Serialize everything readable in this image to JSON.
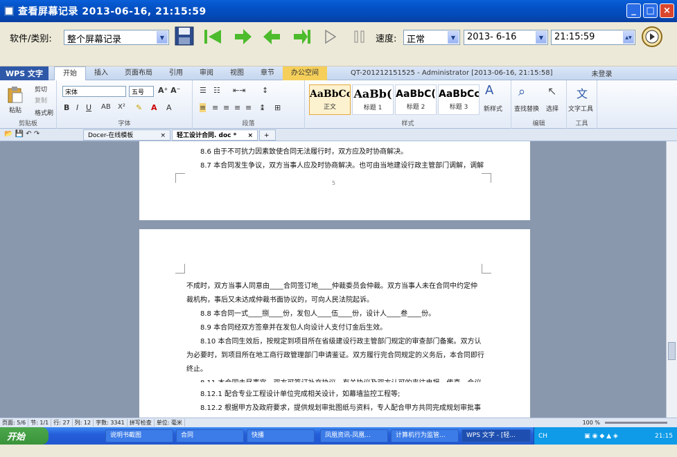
{
  "window": {
    "title": "查看屏幕记录 2013-06-16, 21:15:59"
  },
  "toolbar": {
    "category_label": "软件/类别:",
    "category_value": "整个屏幕记录",
    "speed_label": "速度:",
    "speed_value": "正常",
    "date_value": "2013- 6-16",
    "time_value": "21:15:59"
  },
  "wps": {
    "logo": "WPS 文字",
    "tabs": [
      "开始",
      "插入",
      "页面布局",
      "引用",
      "审阅",
      "视图",
      "章节",
      "办公空间"
    ],
    "title_info": "QT-201212151525 - Administrator [2013-06-16, 21:15:58]",
    "login": "未登录"
  },
  "ribbon": {
    "clipboard": {
      "paste": "粘贴",
      "cut": "剪切",
      "copy": "复制",
      "format_painter": "格式刷",
      "label": "剪贴板"
    },
    "font": {
      "name": "宋体",
      "size": "五号",
      "label": "字体"
    },
    "paragraph": {
      "label": "段落"
    },
    "styles": {
      "items": [
        {
          "sample": "AaBbCcI",
          "name": "正文"
        },
        {
          "sample": "AaBb(",
          "name": "标题 1"
        },
        {
          "sample": "AaBbC(",
          "name": "标题 2"
        },
        {
          "sample": "AaBbCc",
          "name": "标题 3"
        }
      ],
      "new_style": "新样式",
      "label": "样式"
    },
    "edit": {
      "find_replace": "查找替换",
      "select": "选择",
      "label": "编辑"
    },
    "tools": {
      "text_tools": "文字工具",
      "label": "工具"
    }
  },
  "doctabs": {
    "tab1": "Docer-在线模板",
    "tab2": "轻工设计合同. doc *"
  },
  "document": {
    "page1": [
      "8.6 由于不可抗力因素致使合同无法履行时，双方应及时协商解决。",
      "8.7 本合同发生争议，双方当事人应及时协商解决。也可由当地建设行政主管部门调解，调解"
    ],
    "page_number": "5",
    "page2": [
      "不成时，双方当事人同意由____合同签订地____仲裁委员会仲裁。双方当事人未在合同中约定仲",
      "裁机构，事后又未达成仲裁书面协议的，可向人民法院起诉。",
      "8.8 本合同一式____捌____份，发包人____伍____份，设计人____叁____份。",
      "8.9 本合同经双方签章并在发包人向设计人支付订金后生效。",
      "8.10 本合同生效后，按规定到项目所在省级建设行政主管部门规定的审查部门备案。双方认",
      "为必要时，到项目所在地工商行政管理部门申请鉴证。双方履行完合同规定的义务后，本合同即行",
      "终止。",
      "8.11 本合同未尽事宜，双方可签订补充协议，有关协议及双方认可的来往电报、传真、会议",
      "8.12.1 配合专业工程设计单位完成相关设计，如幕墙监控工程等;",
      "8.12.2 根据甲方及政府要求，提供规划审批图纸与资料，专人配合甲方共同完成规划审批事"
    ]
  },
  "statusbar": [
    "页面: 5/6",
    "节: 1/1",
    "行: 27",
    "列: 12",
    "字数: 3341",
    "拼写检查",
    "单位: 毫米"
  ],
  "zoom": "100 %",
  "taskbar": {
    "start": "开始",
    "tasks": [
      "说明书截图",
      "合同",
      "快播",
      "凤凰资讯-凤凰...",
      "计算机行为监管...",
      "WPS 文字 - [轻..."
    ],
    "clock": "21:15",
    "ime": "CH"
  }
}
